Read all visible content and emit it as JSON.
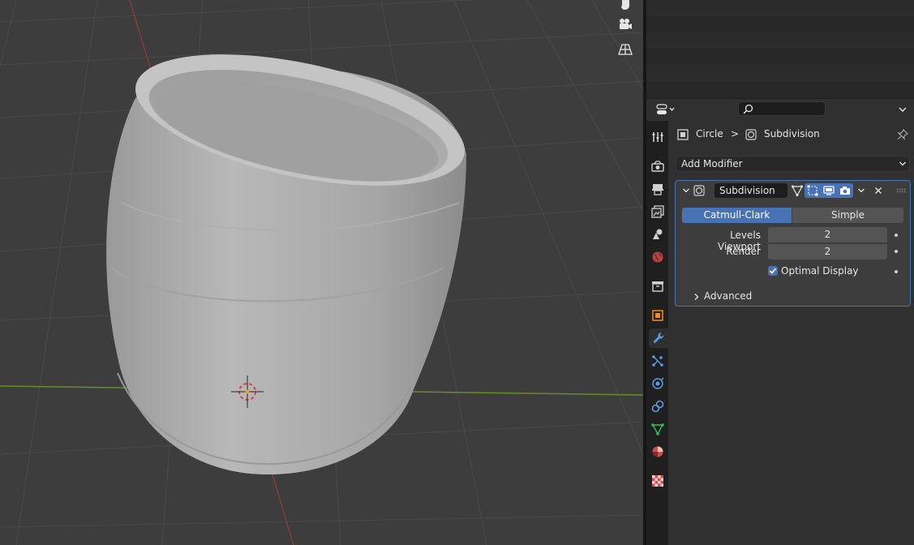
{
  "viewport": {
    "object_name": "Circle",
    "colors": {
      "background": "#3d3d3d",
      "grid": "#4a4a4a",
      "x_axis": "#8a3a3a",
      "y_axis": "#6a8a2a",
      "mesh": "#a8a8a8"
    },
    "gizmos": [
      {
        "name": "hand-icon"
      },
      {
        "name": "camera-icon"
      },
      {
        "name": "perspective-grid-icon"
      }
    ]
  },
  "properties": {
    "search": {
      "placeholder": ""
    },
    "tabs": [
      {
        "name": "tool-icon"
      },
      {
        "name": "render-icon"
      },
      {
        "name": "output-icon"
      },
      {
        "name": "view-layer-icon"
      },
      {
        "name": "scene-icon"
      },
      {
        "name": "world-icon"
      },
      {
        "name": "collection-icon"
      },
      {
        "name": "object-icon"
      },
      {
        "name": "modifier-wrench-icon",
        "active": true
      },
      {
        "name": "particles-icon"
      },
      {
        "name": "physics-icon"
      },
      {
        "name": "constraints-icon"
      },
      {
        "name": "object-data-icon"
      },
      {
        "name": "material-icon"
      },
      {
        "name": "texture-icon"
      }
    ],
    "breadcrumb": {
      "object": "Circle",
      "separator": ">",
      "modifier": "Subdivision"
    },
    "add_modifier_label": "Add Modifier",
    "modifier": {
      "name": "Subdivision",
      "types": [
        "Catmull-Clark",
        "Simple"
      ],
      "active_type": "Catmull-Clark",
      "levels_viewport_label": "Levels Viewport",
      "levels_viewport_value": "2",
      "render_label": "Render",
      "render_value": "2",
      "optimal_display_label": "Optimal Display",
      "optimal_display_checked": true,
      "advanced_label": "Advanced"
    },
    "accent_color": "#4772b3"
  }
}
